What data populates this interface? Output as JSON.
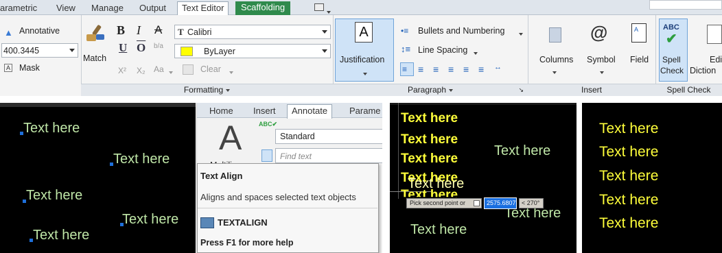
{
  "ribbon": {
    "tabs": [
      "arametric",
      "View",
      "Manage",
      "Output",
      "Text Editor",
      "Scaffolding"
    ],
    "style": {
      "annotative": "Annotative",
      "height": "400.3445",
      "mask": "Mask"
    },
    "formatting": {
      "match": "Match",
      "font": "Calibri",
      "color": "ByLayer",
      "clear": "Clear",
      "bold": "B",
      "italic": "I",
      "strike": "A",
      "underline": "U",
      "overline": "O",
      "stack": "b/a",
      "superscript": "X²",
      "subscript": "X₂",
      "case": "Aa",
      "footer": "Formatting"
    },
    "paragraph": {
      "justification": "Justification",
      "bullets": "Bullets and Numbering",
      "line_spacing": "Line Spacing",
      "footer": "Paragraph"
    },
    "insert": {
      "columns": "Columns",
      "symbol": "Symbol",
      "symbol_glyph": "@",
      "field": "Field",
      "footer": "Insert"
    },
    "spell": {
      "spell": "Spell",
      "check": "Check",
      "edit": "Edi",
      "dictionaries": "Diction",
      "abc": "ABC",
      "footer": "Spell Check"
    }
  },
  "canvas1": {
    "items": [
      "Text here",
      "Text here",
      "Text here",
      "Text here",
      "Text here"
    ]
  },
  "menu": {
    "tabs": [
      "Home",
      "Insert",
      "Annotate",
      "Parame"
    ],
    "style_value": "Standard",
    "find_placeholder": "Find text",
    "big_label": "Multiline",
    "big_glyph": "A",
    "tip_title": "Text Align",
    "tip_desc": "Aligns and spaces selected text objects",
    "command": "TEXTALIGN",
    "help": "Press F1 for more help"
  },
  "canvas3": {
    "stack": [
      "Text here",
      "Text here",
      "Text here",
      "Text here"
    ],
    "right_top": "Text here",
    "overlap_a": "Text here",
    "overlap_b": "Text here",
    "right_bottom": "Text here",
    "bottom": "Text here",
    "prompt": "Pick second point or",
    "value": "2575.6807",
    "angle": "< 270°"
  },
  "canvas4": {
    "items": [
      "Text here",
      "Text here",
      "Text here",
      "Text here",
      "Text here"
    ]
  }
}
